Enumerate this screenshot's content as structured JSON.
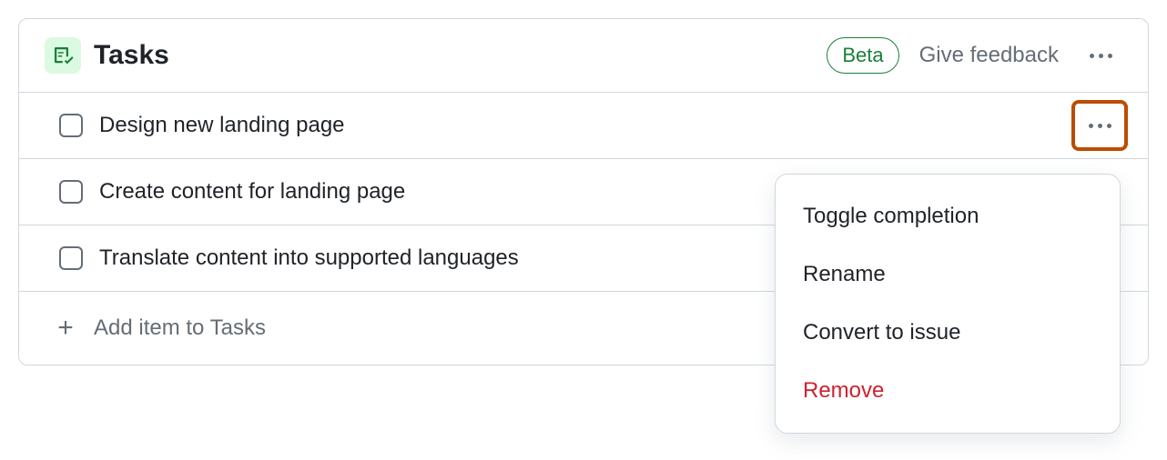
{
  "header": {
    "title": "Tasks",
    "badge": "Beta",
    "feedback": "Give feedback"
  },
  "tasks": [
    {
      "label": "Design new landing page"
    },
    {
      "label": "Create content for landing page"
    },
    {
      "label": "Translate content into supported languages"
    }
  ],
  "addItem": "Add item to Tasks",
  "menu": {
    "toggle": "Toggle completion",
    "rename": "Rename",
    "convert": "Convert to issue",
    "remove": "Remove"
  }
}
